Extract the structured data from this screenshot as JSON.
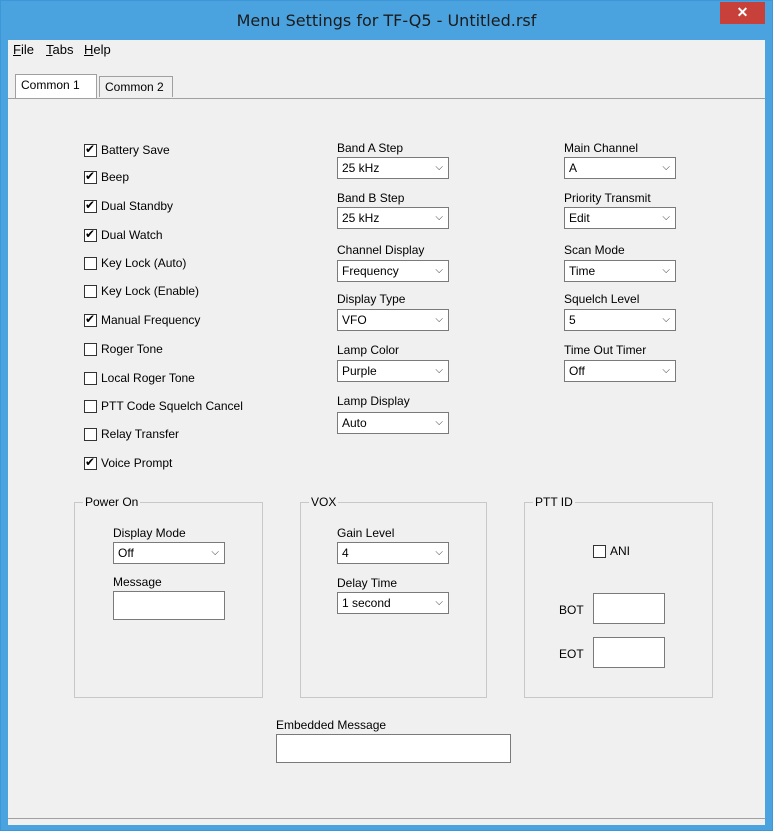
{
  "window": {
    "title": "Menu Settings for TF-Q5 - Untitled.rsf",
    "close_label": "✕"
  },
  "menubar": {
    "items": [
      {
        "mnemonic": "F",
        "rest": "ile"
      },
      {
        "mnemonic": "T",
        "rest": "abs"
      },
      {
        "mnemonic": "H",
        "rest": "elp"
      }
    ]
  },
  "tabs": [
    {
      "label": "Common 1",
      "active": true
    },
    {
      "label": "Common 2",
      "active": false
    }
  ],
  "checkboxes": [
    {
      "label": "Battery Save",
      "checked": true
    },
    {
      "label": "Beep",
      "checked": true
    },
    {
      "label": "Dual Standby",
      "checked": true
    },
    {
      "label": "Dual Watch",
      "checked": true
    },
    {
      "label": "Key Lock (Auto)",
      "checked": false
    },
    {
      "label": "Key Lock (Enable)",
      "checked": false
    },
    {
      "label": "Manual Frequency",
      "checked": true
    },
    {
      "label": "Roger Tone",
      "checked": false
    },
    {
      "label": "Local Roger Tone",
      "checked": false
    },
    {
      "label": "PTT Code Squelch Cancel",
      "checked": false
    },
    {
      "label": "Relay Transfer",
      "checked": false
    },
    {
      "label": "Voice Prompt",
      "checked": true
    }
  ],
  "col2": [
    {
      "label": "Band A Step",
      "value": "25 kHz"
    },
    {
      "label": "Band B Step",
      "value": "25 kHz"
    },
    {
      "label": "Channel Display",
      "value": "Frequency"
    },
    {
      "label": "Display Type",
      "value": "VFO"
    },
    {
      "label": "Lamp Color",
      "value": "Purple"
    },
    {
      "label": "Lamp Display",
      "value": "Auto"
    }
  ],
  "col3": [
    {
      "label": "Main Channel",
      "value": "A"
    },
    {
      "label": "Priority Transmit",
      "value": "Edit"
    },
    {
      "label": "Scan Mode",
      "value": "Time"
    },
    {
      "label": "Squelch Level",
      "value": "5"
    },
    {
      "label": "Time Out Timer",
      "value": "Off"
    }
  ],
  "power_on": {
    "title": "Power On",
    "display_mode_label": "Display Mode",
    "display_mode_value": "Off",
    "message_label": "Message",
    "message_value": ""
  },
  "vox": {
    "title": "VOX",
    "gain_label": "Gain Level",
    "gain_value": "4",
    "delay_label": "Delay Time",
    "delay_value": "1 second"
  },
  "ptt_id": {
    "title": "PTT ID",
    "ani_label": "ANI",
    "ani_checked": false,
    "bot_label": "BOT",
    "bot_value": "",
    "eot_label": "EOT",
    "eot_value": ""
  },
  "embedded": {
    "label": "Embedded Message",
    "value": ""
  },
  "icons": {
    "dropdown_arrow": "⌵",
    "check": "✔"
  }
}
